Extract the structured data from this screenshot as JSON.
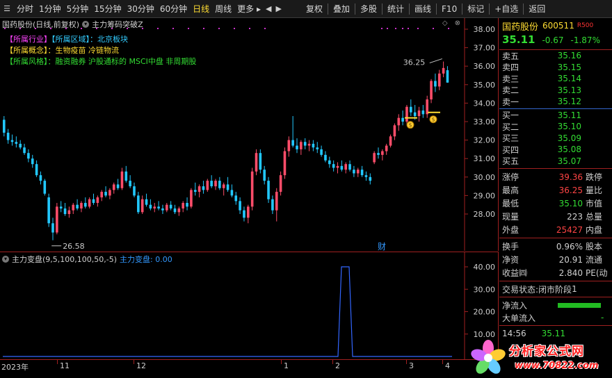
{
  "toolbar": {
    "periods": [
      "分时",
      "1分钟",
      "5分钟",
      "15分钟",
      "30分钟",
      "60分钟",
      "日线",
      "周线",
      "更多"
    ],
    "active_period": "日线",
    "tools": [
      "复权",
      "叠加",
      "多股",
      "统计",
      "画线",
      "F10",
      "标记",
      "+自选",
      "返回"
    ]
  },
  "main_chart": {
    "title": "国药股份(日线,前复权)",
    "indicator": "主力筹码突破Z",
    "info": {
      "industry_tag": "【所属行业】",
      "region_tag": "【所属区域】",
      "region_value": "北京板块",
      "concept_tag": "【所属概念】",
      "concept_value": "生物疫苗 冷链物流",
      "style_tag": "【所属风格】",
      "style_value": "融资融券 沪股通标的 MSCI中盘 非周期股"
    },
    "y_ticks": [
      "38.00",
      "37.00",
      "36.00",
      "35.00",
      "34.00",
      "33.00",
      "32.00",
      "31.00",
      "30.00",
      "29.00",
      "28.00"
    ],
    "high_label": "36.25",
    "low_label": "26.58",
    "finance_marker": "财"
  },
  "volume_chart": {
    "title": "主力变盘(9,5,100,100,50,-5)",
    "value_label": "主力变盘: 0.00",
    "y_ticks": [
      "40.00",
      "30.00",
      "20.00",
      "10.00"
    ]
  },
  "time_axis": {
    "labels": [
      "2023年",
      "11",
      "12",
      "1",
      "2",
      "3",
      "4"
    ]
  },
  "right_panel": {
    "name": "国药股份",
    "code": "600511",
    "flag": "R500",
    "price": "35.11",
    "change": "-0.67",
    "change_pct": "-1.87%",
    "asks": [
      {
        "label": "卖五",
        "price": "35.16"
      },
      {
        "label": "卖四",
        "price": "35.15"
      },
      {
        "label": "卖三",
        "price": "35.14"
      },
      {
        "label": "卖二",
        "price": "35.13"
      },
      {
        "label": "卖一",
        "price": "35.12"
      }
    ],
    "bids": [
      {
        "label": "买一",
        "price": "35.11"
      },
      {
        "label": "买二",
        "price": "35.10"
      },
      {
        "label": "买三",
        "price": "35.09"
      },
      {
        "label": "买四",
        "price": "35.08"
      },
      {
        "label": "买五",
        "price": "35.07"
      }
    ],
    "stats1": [
      {
        "label": "涨停",
        "value": "39.36",
        "color": "#ff4444",
        "label2": "跌停"
      },
      {
        "label": "最高",
        "value": "36.25",
        "color": "#ff4444",
        "label2": "量比"
      },
      {
        "label": "最低",
        "value": "35.10",
        "color": "#33dd33",
        "label2": "市值"
      },
      {
        "label": "现量",
        "value": "223",
        "color": "#d0d0d0",
        "label2": "总量"
      },
      {
        "label": "外盘",
        "value": "25427",
        "color": "#ff4444",
        "label2": "内盘"
      }
    ],
    "stats2": [
      {
        "label": "换手",
        "value": "0.96%",
        "color": "#d0d0d0",
        "label2": "股本"
      },
      {
        "label": "净资",
        "value": "20.91",
        "color": "#d0d0d0",
        "label2": "流通"
      },
      {
        "label": "收益㈣",
        "value": "2.840",
        "color": "#d0d0d0",
        "label2": "PE(动"
      }
    ],
    "trade_state_label": "交易状态:",
    "trade_state_value": "闭市阶段",
    "trade_state_extra": "1",
    "net_inflow_label": "净流入",
    "big_inflow_label": "大单流入",
    "big_inflow_value": "-",
    "last_time": "14:56",
    "last_price": "35.11"
  },
  "watermark": {
    "title": "分析家公式网",
    "url": "www.70822.com"
  }
}
